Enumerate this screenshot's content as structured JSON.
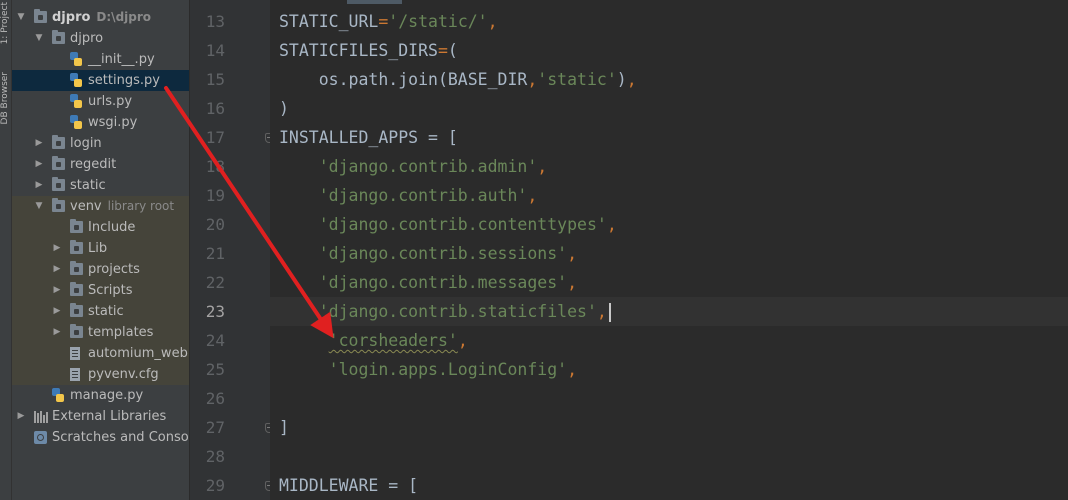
{
  "toolstrip": {
    "project_tab": "1: Project",
    "db_tab": "DB Browser"
  },
  "tree": [
    {
      "label": "djpro",
      "hint": "D:\\djpro",
      "depth": 0,
      "icon": "folder",
      "expanded": true,
      "bold": true
    },
    {
      "label": "djpro",
      "depth": 1,
      "icon": "folder",
      "expanded": true
    },
    {
      "label": "__init__.py",
      "depth": 2,
      "icon": "python-file"
    },
    {
      "label": "settings.py",
      "depth": 2,
      "icon": "python-file",
      "selected": true
    },
    {
      "label": "urls.py",
      "depth": 2,
      "icon": "python-file"
    },
    {
      "label": "wsgi.py",
      "depth": 2,
      "icon": "python-file"
    },
    {
      "label": "login",
      "depth": 1,
      "icon": "folder",
      "expanded": false
    },
    {
      "label": "regedit",
      "depth": 1,
      "icon": "folder",
      "expanded": false
    },
    {
      "label": "static",
      "depth": 1,
      "icon": "folder",
      "expanded": false
    },
    {
      "label": "venv",
      "hint": "library root",
      "depth": 1,
      "icon": "folder",
      "expanded": true,
      "venv": true
    },
    {
      "label": "Include",
      "depth": 2,
      "icon": "folder",
      "venv": true
    },
    {
      "label": "Lib",
      "depth": 2,
      "icon": "folder",
      "expanded": false,
      "venv": true
    },
    {
      "label": "projects",
      "depth": 2,
      "icon": "folder",
      "expanded": false,
      "venv": true
    },
    {
      "label": "Scripts",
      "depth": 2,
      "icon": "folder",
      "expanded": false,
      "venv": true
    },
    {
      "label": "static",
      "depth": 2,
      "icon": "folder",
      "expanded": false,
      "venv": true
    },
    {
      "label": "templates",
      "depth": 2,
      "icon": "folder",
      "expanded": false,
      "venv": true
    },
    {
      "label": "automium_web.ws",
      "depth": 2,
      "icon": "config-file",
      "venv": true
    },
    {
      "label": "pyvenv.cfg",
      "depth": 2,
      "icon": "config-file",
      "venv": true
    },
    {
      "label": "manage.py",
      "depth": 1,
      "icon": "python-file"
    },
    {
      "label": "External Libraries",
      "depth": 0,
      "icon": "library",
      "expanded": false
    },
    {
      "label": "Scratches and Consoles",
      "depth": 0,
      "icon": "scratches"
    }
  ],
  "editor": {
    "current_line": "23",
    "lines": [
      {
        "num": "13",
        "code": [
          [
            "d",
            "STATIC_URL"
          ],
          [
            "k",
            "="
          ],
          [
            "s",
            "'/static/'"
          ],
          [
            "k",
            ","
          ]
        ]
      },
      {
        "num": "14",
        "code": [
          [
            "d",
            "STATICFILES_DIRS"
          ],
          [
            "k",
            "="
          ],
          [
            "d",
            "("
          ]
        ]
      },
      {
        "num": "15",
        "code": [
          [
            "d",
            "    os.path.join(BASE_DIR"
          ],
          [
            "k",
            ","
          ],
          [
            "s",
            "'static'"
          ],
          [
            "d",
            ")"
          ],
          [
            "k",
            ","
          ]
        ]
      },
      {
        "num": "16",
        "code": [
          [
            "d",
            ")"
          ]
        ]
      },
      {
        "num": "17",
        "code": [
          [
            "d",
            "INSTALLED_APPS = ["
          ]
        ],
        "fold": true
      },
      {
        "num": "18",
        "code": [
          [
            "s",
            "    'django.contrib.admin'"
          ],
          [
            "k",
            ","
          ]
        ]
      },
      {
        "num": "19",
        "code": [
          [
            "s",
            "    'django.contrib.auth'"
          ],
          [
            "k",
            ","
          ]
        ]
      },
      {
        "num": "20",
        "code": [
          [
            "s",
            "    'django.contrib.contenttypes'"
          ],
          [
            "k",
            ","
          ]
        ]
      },
      {
        "num": "21",
        "code": [
          [
            "s",
            "    'django.contrib.sessions'"
          ],
          [
            "k",
            ","
          ]
        ]
      },
      {
        "num": "22",
        "code": [
          [
            "s",
            "    'django.contrib.messages'"
          ],
          [
            "k",
            ","
          ]
        ]
      },
      {
        "num": "23",
        "code": [
          [
            "s",
            "    'django.contrib.staticfiles'"
          ],
          [
            "k",
            ","
          ]
        ],
        "caret": true
      },
      {
        "num": "24",
        "code": [
          [
            "d",
            "     "
          ],
          [
            "sq",
            "'corsheaders'"
          ],
          [
            "k",
            ","
          ]
        ]
      },
      {
        "num": "25",
        "code": [
          [
            "s",
            "     'login.apps.LoginConfig'"
          ],
          [
            "k",
            ","
          ]
        ]
      },
      {
        "num": "26",
        "code": [
          [
            "d",
            ""
          ]
        ]
      },
      {
        "num": "27",
        "code": [
          [
            "d",
            "]"
          ]
        ],
        "fold": true
      },
      {
        "num": "28",
        "code": [
          [
            "d",
            ""
          ]
        ]
      },
      {
        "num": "29",
        "code": [
          [
            "d",
            "MIDDLEWARE = ["
          ]
        ],
        "fold": true
      }
    ]
  },
  "colors": {
    "arrow": "#e02020",
    "string": "#6a8759",
    "keyword": "#cc7832",
    "text": "#a9b7c6"
  }
}
